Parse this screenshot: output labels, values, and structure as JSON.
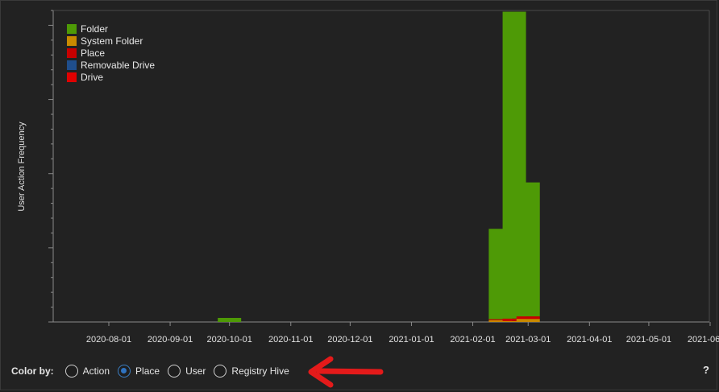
{
  "chart_data": {
    "type": "bar",
    "stacked": true,
    "ylabel": "User Action Frequency",
    "x_ticks": [
      "2020-08-01",
      "2020-09-01",
      "2020-10-01",
      "2020-11-01",
      "2020-12-01",
      "2021-01-01",
      "2021-02-01",
      "2021-03-01",
      "2021-04-01",
      "2021-05-01",
      "2021-06-01"
    ],
    "ylim": [
      0,
      100
    ],
    "legend_position": "top-left",
    "series": [
      {
        "name": "Folder",
        "color": "#4e9a06"
      },
      {
        "name": "System Folder",
        "color": "#c98a00"
      },
      {
        "name": "Place",
        "color": "#c80000"
      },
      {
        "name": "Removable Drive",
        "color": "#1f4e8c"
      },
      {
        "name": "Drive",
        "color": "#e00000"
      }
    ],
    "bars": [
      {
        "date": "2020-10-01",
        "Folder": 1.3,
        "System Folder": 0,
        "Place": 0,
        "Removable Drive": 0,
        "Drive": 0
      },
      {
        "date": "2021-02-15",
        "Folder": 29,
        "System Folder": 0.6,
        "Place": 0.3,
        "Removable Drive": 0,
        "Drive": 0
      },
      {
        "date": "2021-02-22",
        "Folder": 98.5,
        "System Folder": 0.3,
        "Place": 0.8,
        "Removable Drive": 0,
        "Drive": 0
      },
      {
        "date": "2021-03-01",
        "Folder": 43,
        "System Folder": 1,
        "Place": 0.8,
        "Removable Drive": 0,
        "Drive": 0
      }
    ]
  },
  "controls": {
    "color_by_label": "Color by:",
    "options": [
      {
        "label": "Action",
        "selected": false
      },
      {
        "label": "Place",
        "selected": true
      },
      {
        "label": "User",
        "selected": false
      },
      {
        "label": "Registry Hive",
        "selected": false
      }
    ],
    "help_label": "?"
  },
  "colors": {
    "background": "#222222",
    "axis": "#8a8a8a",
    "annotation_arrow": "#e41a1a"
  }
}
